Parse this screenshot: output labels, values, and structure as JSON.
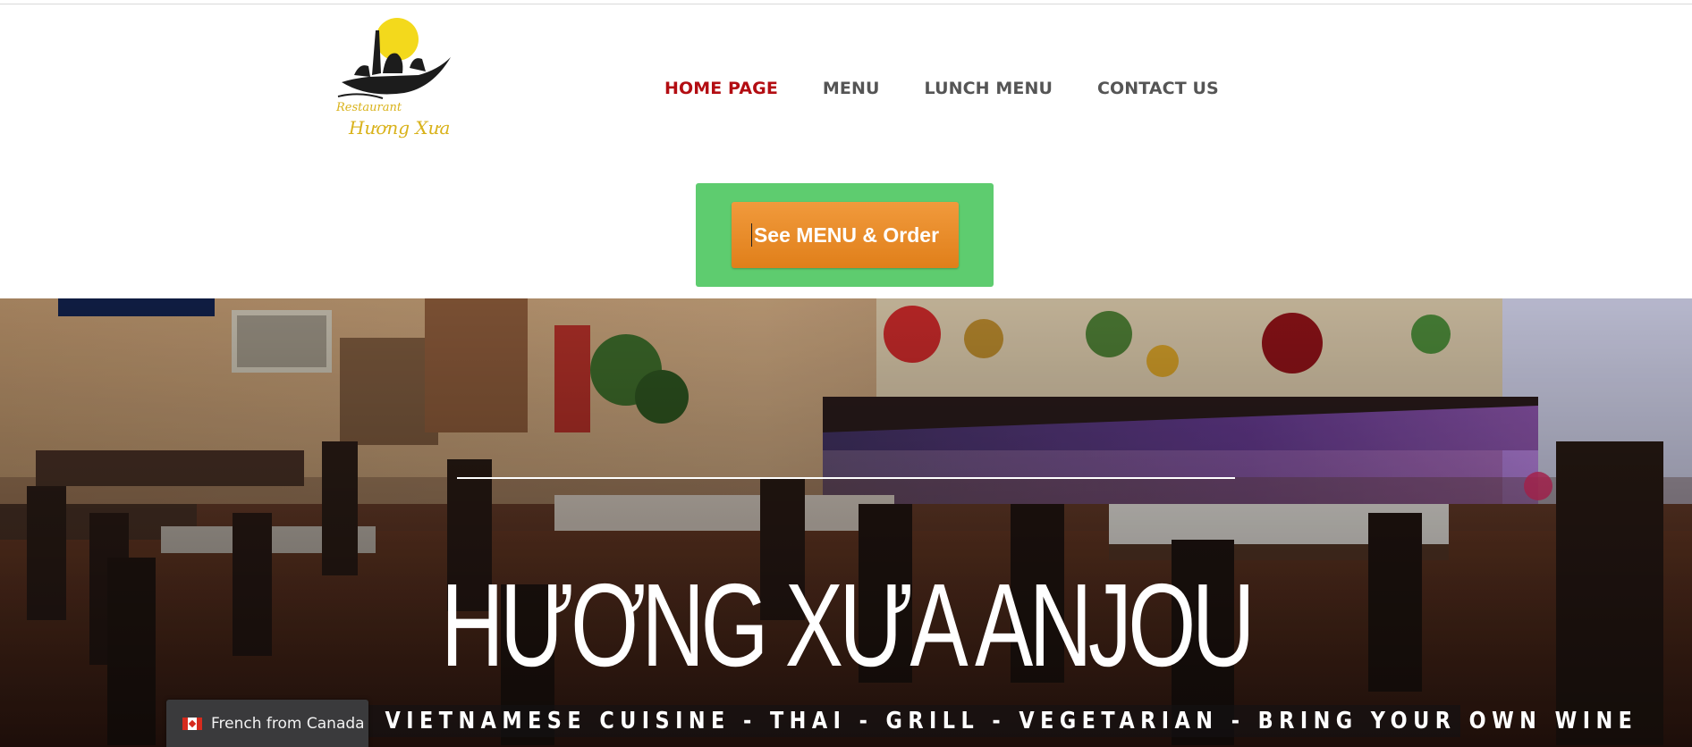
{
  "header": {
    "logo": {
      "alt": "Restaurant Huong Xua logo",
      "text_line1": "Restaurant",
      "text_line2": "Hương Xưa"
    },
    "nav": [
      {
        "label": "HOME PAGE",
        "active": true
      },
      {
        "label": "MENU",
        "active": false
      },
      {
        "label": "LUNCH MENU",
        "active": false
      },
      {
        "label": "CONTACT US",
        "active": false
      }
    ]
  },
  "cta": {
    "label": "See MENU & Order"
  },
  "hero": {
    "title": "HƯƠNG XƯA ANJOU",
    "subtitle": "VIETNAMESE CUISINE - THAI - GRILL - VEGETARIAN - BRING YOUR OWN WINE"
  },
  "language_widget": {
    "label": "French from Canada",
    "flag_icon": "canada-flag-icon"
  },
  "colors": {
    "nav_active": "#b30d12",
    "nav_default": "#555555",
    "cta_frame": "#5ecc6f",
    "cta_button": "#e88a26"
  }
}
